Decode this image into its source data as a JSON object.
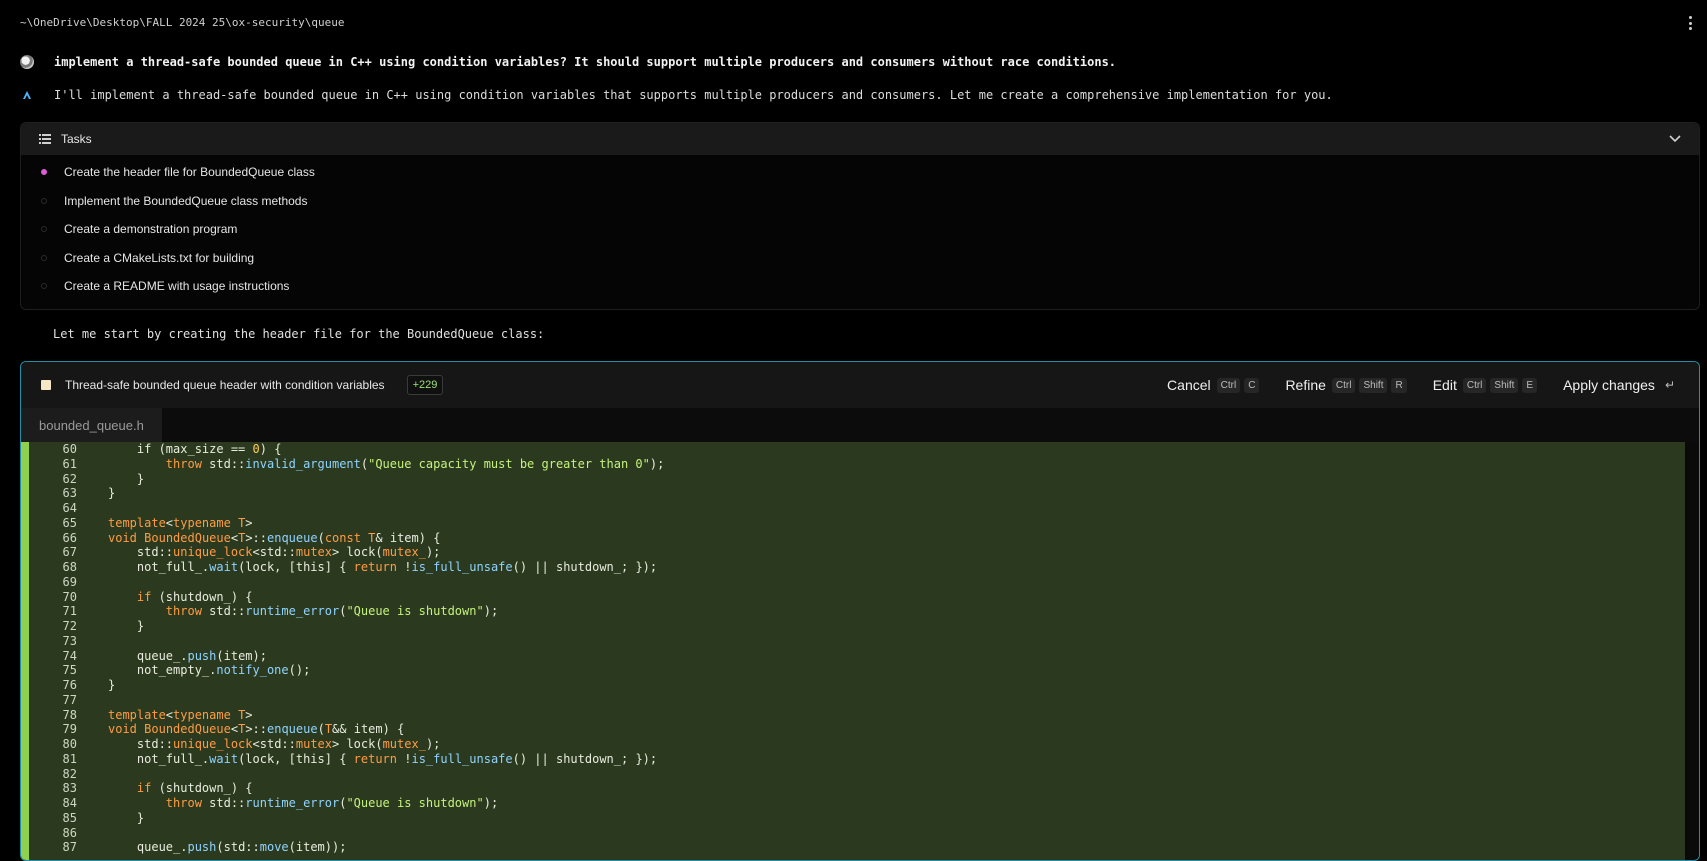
{
  "path": "~\\OneDrive\\Desktop\\FALL 2024 25\\ox-security\\queue",
  "user_message": "implement a thread-safe bounded queue in C++ using condition variables? It should support multiple producers and consumers without race conditions.",
  "ai_message": "I'll implement a thread-safe bounded queue in C++ using condition variables that supports multiple producers and consumers. Let me create a comprehensive implementation for you.",
  "tasks": {
    "title": "Tasks",
    "items": [
      {
        "label": "Create the header file for BoundedQueue class",
        "active": true
      },
      {
        "label": "Implement the BoundedQueue class methods",
        "active": false
      },
      {
        "label": "Create a demonstration program",
        "active": false
      },
      {
        "label": "Create a CMakeLists.txt for building",
        "active": false
      },
      {
        "label": "Create a README with usage instructions",
        "active": false
      }
    ]
  },
  "follow_up": "Let me start by creating the header file for the BoundedQueue class:",
  "edit": {
    "title": "Thread-safe bounded queue header with condition variables",
    "diff": "+229",
    "actions": [
      {
        "label": "Cancel",
        "keys": [
          "Ctrl",
          "C"
        ]
      },
      {
        "label": "Refine",
        "keys": [
          "Ctrl",
          "Shift",
          "R"
        ]
      },
      {
        "label": "Edit",
        "keys": [
          "Ctrl",
          "Shift",
          "E"
        ]
      },
      {
        "label": "Apply changes",
        "keys": [
          "↵"
        ]
      }
    ],
    "file_tab": "bounded_queue.h"
  },
  "code_lines": [
    {
      "n": "60",
      "t": [
        [
          "",
          "    if (max_size "
        ],
        [
          "",
          "== "
        ],
        [
          "num",
          "0"
        ],
        [
          "",
          ") {"
        ]
      ]
    },
    {
      "n": "61",
      "t": [
        [
          "",
          "        "
        ],
        [
          "kw",
          "throw"
        ],
        [
          "",
          " std::"
        ],
        [
          "fn",
          "invalid_argument"
        ],
        [
          "",
          "("
        ],
        [
          "str",
          "\"Queue capacity must be greater than 0\""
        ],
        [
          "",
          ");"
        ]
      ]
    },
    {
      "n": "62",
      "t": [
        [
          "",
          "    }"
        ]
      ]
    },
    {
      "n": "63",
      "t": [
        [
          "",
          "}"
        ]
      ]
    },
    {
      "n": "64",
      "t": [
        [
          "",
          ""
        ]
      ]
    },
    {
      "n": "65",
      "t": [
        [
          "kw",
          "template"
        ],
        [
          "",
          "<"
        ],
        [
          "kw",
          "typename"
        ],
        [
          "",
          " "
        ],
        [
          "ty",
          "T"
        ],
        [
          "",
          ">"
        ]
      ]
    },
    {
      "n": "66",
      "t": [
        [
          "kw",
          "void"
        ],
        [
          "",
          " "
        ],
        [
          "ty",
          "BoundedQueue"
        ],
        [
          "",
          "<"
        ],
        [
          "ty",
          "T"
        ],
        [
          "",
          ">::"
        ],
        [
          "fn",
          "enqueue"
        ],
        [
          "",
          "("
        ],
        [
          "kw",
          "const"
        ],
        [
          "",
          " "
        ],
        [
          "ty",
          "T"
        ],
        [
          "",
          "& item) {"
        ]
      ]
    },
    {
      "n": "67",
      "t": [
        [
          "",
          "    std::"
        ],
        [
          "ty",
          "unique_lock"
        ],
        [
          "",
          "<std::"
        ],
        [
          "ty",
          "mutex"
        ],
        [
          "",
          "> lock("
        ],
        [
          "kw",
          "mutex_"
        ],
        [
          "",
          ");"
        ]
      ]
    },
    {
      "n": "68",
      "t": [
        [
          "",
          "    not_full_."
        ],
        [
          "fn",
          "wait"
        ],
        [
          "",
          "(lock, [this] { "
        ],
        [
          "kw",
          "return"
        ],
        [
          "",
          " !"
        ],
        [
          "fn",
          "is_full_unsafe"
        ],
        [
          "",
          "() || shutdown_; });"
        ]
      ]
    },
    {
      "n": "69",
      "t": [
        [
          "",
          ""
        ]
      ]
    },
    {
      "n": "70",
      "t": [
        [
          "",
          "    "
        ],
        [
          "kw",
          "if"
        ],
        [
          "",
          " (shutdown_) {"
        ]
      ]
    },
    {
      "n": "71",
      "t": [
        [
          "",
          "        "
        ],
        [
          "kw",
          "throw"
        ],
        [
          "",
          " std::"
        ],
        [
          "fn",
          "runtime_error"
        ],
        [
          "",
          "("
        ],
        [
          "str",
          "\"Queue is shutdown\""
        ],
        [
          "",
          ");"
        ]
      ]
    },
    {
      "n": "72",
      "t": [
        [
          "",
          "    }"
        ]
      ]
    },
    {
      "n": "73",
      "t": [
        [
          "",
          ""
        ]
      ]
    },
    {
      "n": "74",
      "t": [
        [
          "",
          "    queue_."
        ],
        [
          "fn",
          "push"
        ],
        [
          "",
          "(item);"
        ]
      ]
    },
    {
      "n": "75",
      "t": [
        [
          "",
          "    not_empty_."
        ],
        [
          "fn",
          "notify_one"
        ],
        [
          "",
          "();"
        ]
      ]
    },
    {
      "n": "76",
      "t": [
        [
          "",
          "}"
        ]
      ]
    },
    {
      "n": "77",
      "t": [
        [
          "",
          ""
        ]
      ]
    },
    {
      "n": "78",
      "t": [
        [
          "kw",
          "template"
        ],
        [
          "",
          "<"
        ],
        [
          "kw",
          "typename"
        ],
        [
          "",
          " "
        ],
        [
          "ty",
          "T"
        ],
        [
          "",
          ">"
        ]
      ]
    },
    {
      "n": "79",
      "t": [
        [
          "kw",
          "void"
        ],
        [
          "",
          " "
        ],
        [
          "ty",
          "BoundedQueue"
        ],
        [
          "",
          "<"
        ],
        [
          "ty",
          "T"
        ],
        [
          "",
          ">::"
        ],
        [
          "fn",
          "enqueue"
        ],
        [
          "",
          "("
        ],
        [
          "ty",
          "T"
        ],
        [
          "",
          "&& item) {"
        ]
      ]
    },
    {
      "n": "80",
      "t": [
        [
          "",
          "    std::"
        ],
        [
          "ty",
          "unique_lock"
        ],
        [
          "",
          "<std::"
        ],
        [
          "ty",
          "mutex"
        ],
        [
          "",
          "> lock("
        ],
        [
          "kw",
          "mutex_"
        ],
        [
          "",
          ");"
        ]
      ]
    },
    {
      "n": "81",
      "t": [
        [
          "",
          "    not_full_."
        ],
        [
          "fn",
          "wait"
        ],
        [
          "",
          "(lock, [this] { "
        ],
        [
          "kw",
          "return"
        ],
        [
          "",
          " !"
        ],
        [
          "fn",
          "is_full_unsafe"
        ],
        [
          "",
          "() || shutdown_; });"
        ]
      ]
    },
    {
      "n": "82",
      "t": [
        [
          "",
          ""
        ]
      ]
    },
    {
      "n": "83",
      "t": [
        [
          "",
          "    "
        ],
        [
          "kw",
          "if"
        ],
        [
          "",
          " (shutdown_) {"
        ]
      ]
    },
    {
      "n": "84",
      "t": [
        [
          "",
          "        "
        ],
        [
          "kw",
          "throw"
        ],
        [
          "",
          " std::"
        ],
        [
          "fn",
          "runtime_error"
        ],
        [
          "",
          "("
        ],
        [
          "str",
          "\"Queue is shutdown\""
        ],
        [
          "",
          ");"
        ]
      ]
    },
    {
      "n": "85",
      "t": [
        [
          "",
          "    }"
        ]
      ]
    },
    {
      "n": "86",
      "t": [
        [
          "",
          ""
        ]
      ]
    },
    {
      "n": "87",
      "t": [
        [
          "",
          "    queue_."
        ],
        [
          "fn",
          "push"
        ],
        [
          "",
          "(std::"
        ],
        [
          "fn",
          "move"
        ],
        [
          "",
          "(item));"
        ]
      ]
    }
  ]
}
